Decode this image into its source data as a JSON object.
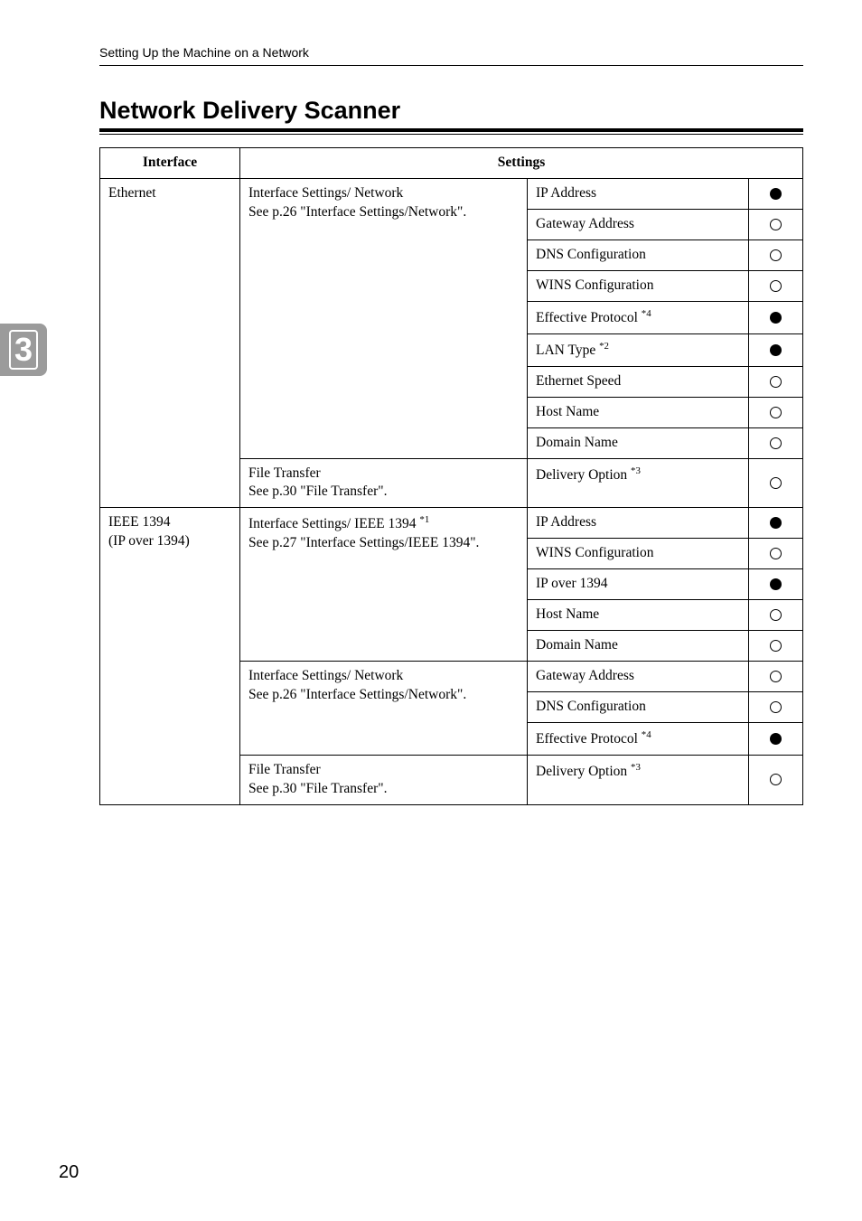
{
  "running_head": "Setting Up the Machine on a Network",
  "tab_number": "3",
  "section_heading": "Network Delivery Scanner",
  "page_number": "20",
  "table": {
    "headers": {
      "interface": "Interface",
      "settings": "Settings"
    },
    "groups": [
      {
        "interface": "Ethernet",
        "blocks": [
          {
            "block_label": "Interface Settings/ Network",
            "block_note": "See p.26 \"Interface Settings/Network\".",
            "rows": [
              {
                "setting": "IP Address",
                "mark": "filled"
              },
              {
                "setting": "Gateway Address",
                "mark": "hollow"
              },
              {
                "setting": "DNS Configuration",
                "mark": "hollow"
              },
              {
                "setting": "WINS Configuration",
                "mark": "hollow"
              },
              {
                "setting": "Effective Protocol ",
                "sup": "*4",
                "mark": "filled"
              },
              {
                "setting": "LAN Type ",
                "sup": "*2",
                "mark": "filled"
              },
              {
                "setting": "Ethernet Speed",
                "mark": "hollow"
              },
              {
                "setting": "Host Name",
                "mark": "hollow"
              },
              {
                "setting": "Domain Name",
                "mark": "hollow"
              }
            ]
          },
          {
            "block_label": "File Transfer",
            "block_note": "See p.30 \"File Transfer\".",
            "rows": [
              {
                "setting": "Delivery Option ",
                "sup": "*3",
                "mark": "hollow"
              }
            ]
          }
        ]
      },
      {
        "interface": "IEEE 1394",
        "interface_sub": "(IP over 1394)",
        "blocks": [
          {
            "block_label": "Interface Settings/ IEEE 1394 ",
            "block_sup": "*1",
            "block_note": "See p.27 \"Interface Settings/IEEE 1394\".",
            "rows": [
              {
                "setting": "IP Address",
                "mark": "filled"
              },
              {
                "setting": "WINS Configuration",
                "mark": "hollow"
              },
              {
                "setting": "IP over 1394",
                "mark": "filled"
              },
              {
                "setting": "Host Name",
                "mark": "hollow"
              },
              {
                "setting": "Domain Name",
                "mark": "hollow"
              }
            ]
          },
          {
            "block_label": "Interface Settings/ Network",
            "block_note": "See p.26 \"Interface Settings/Network\".",
            "rows": [
              {
                "setting": "Gateway Address",
                "mark": "hollow"
              },
              {
                "setting": "DNS Configuration",
                "mark": "hollow"
              },
              {
                "setting": "Effective Protocol ",
                "sup": "*4",
                "mark": "filled"
              }
            ]
          },
          {
            "block_label": "File Transfer",
            "block_note": "See p.30 \"File Transfer\".",
            "rows": [
              {
                "setting": "Delivery Option ",
                "sup": "*3",
                "mark": "hollow"
              }
            ]
          }
        ]
      }
    ]
  }
}
